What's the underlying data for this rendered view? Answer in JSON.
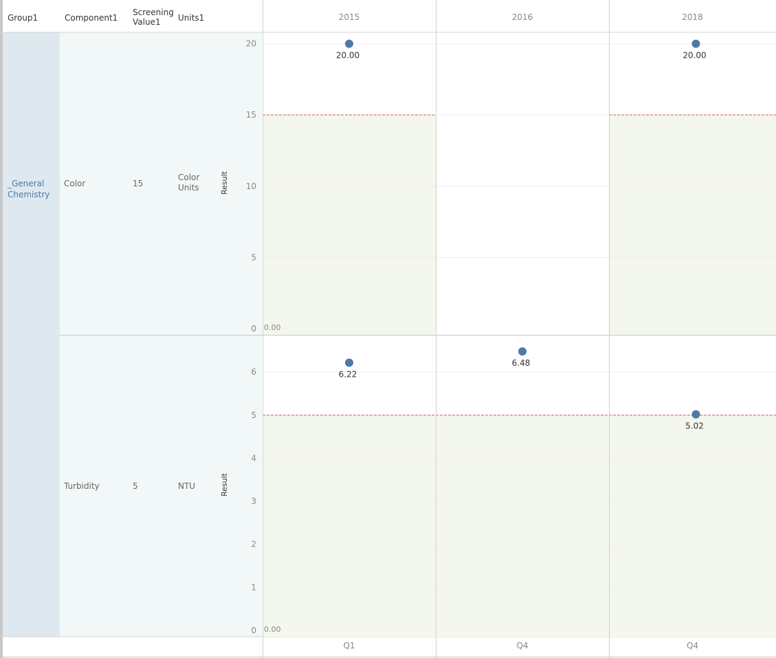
{
  "headers": {
    "group": "Group1",
    "component": "Component1",
    "screening_line1": "Screening",
    "screening_line2": "Value1",
    "units": "Units1"
  },
  "columns": [
    "2015",
    "2016",
    "2018"
  ],
  "footer": [
    "Q1",
    "Q4",
    "Q4"
  ],
  "group_label_line1": "_General",
  "group_label_line2": "Chemistry",
  "rows": [
    {
      "component": "Color",
      "screening": "15",
      "units_line1": "Color",
      "units_line2": "Units",
      "axis_title": "Result"
    },
    {
      "component": "Turbidity",
      "screening": "5",
      "units_line1": "NTU",
      "units_line2": "",
      "axis_title": "Result"
    }
  ],
  "colors": {
    "mark": "#4e79a7",
    "threshold_line": "#e15759",
    "band": "#f4f7ee",
    "group_bg": "#dde9ef",
    "row_bg": "#f2f8f8"
  },
  "chart_data": [
    {
      "type": "scatter",
      "component": "Color",
      "ylabel": "Result",
      "ylim": [
        0,
        20.8
      ],
      "yticks": [
        0,
        5,
        10,
        15,
        20
      ],
      "threshold": 15,
      "zero_label": "0.00",
      "panels": [
        {
          "column": "2015",
          "x": "Q1",
          "points": [
            20.0
          ],
          "labels": [
            "20.00"
          ],
          "band": true
        },
        {
          "column": "2016",
          "x": "Q4",
          "points": [],
          "labels": [],
          "band": false
        },
        {
          "column": "2018",
          "x": "Q4",
          "points": [
            20.0
          ],
          "labels": [
            "20.00"
          ],
          "band": true
        }
      ]
    },
    {
      "type": "scatter",
      "component": "Turbidity",
      "ylabel": "Result",
      "ylim": [
        0,
        6.85
      ],
      "yticks": [
        0,
        1,
        2,
        3,
        4,
        5,
        6
      ],
      "threshold": 5,
      "zero_label": "0.00",
      "panels": [
        {
          "column": "2015",
          "x": "Q1",
          "points": [
            6.22
          ],
          "labels": [
            "6.22"
          ],
          "band": true
        },
        {
          "column": "2016",
          "x": "Q4",
          "points": [
            6.48
          ],
          "labels": [
            "6.48"
          ],
          "band": true
        },
        {
          "column": "2018",
          "x": "Q4",
          "points": [
            5.02
          ],
          "labels": [
            "5.02"
          ],
          "band": true
        }
      ]
    }
  ]
}
